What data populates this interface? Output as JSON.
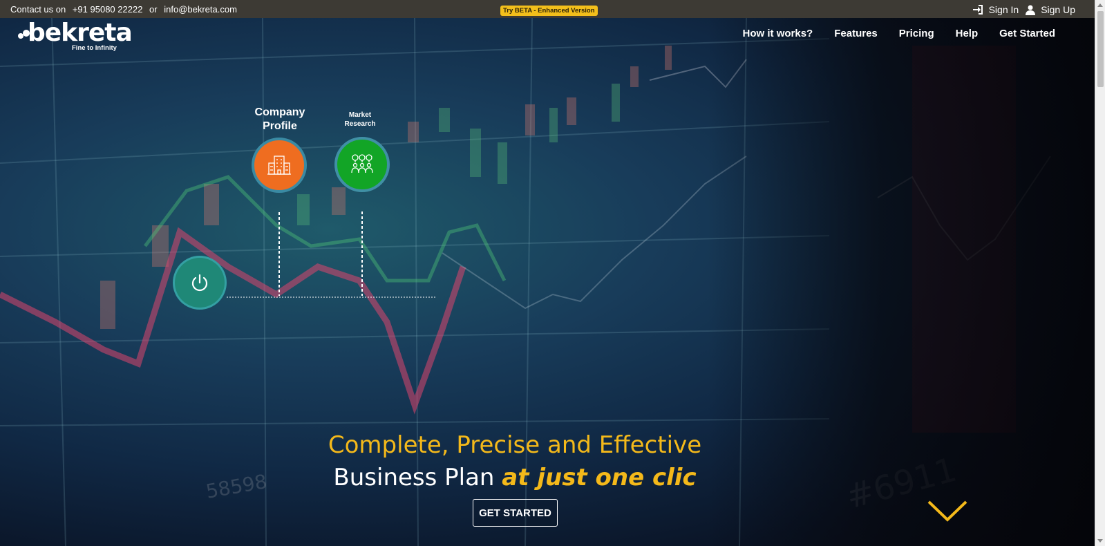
{
  "topbar": {
    "contact_label": "Contact us on",
    "phone": "+91 95080 22222",
    "or": "or",
    "email": "info@bekreta.com",
    "beta_badge": "Try BETA - Enhanced Version",
    "sign_in": "Sign In",
    "sign_up": "Sign Up"
  },
  "logo": {
    "name": "bekreta",
    "tagline": "Fine to Infinity"
  },
  "nav": {
    "items": [
      "How it works?",
      "Features",
      "Pricing",
      "Help",
      "Get Started"
    ]
  },
  "diagram": {
    "profile_label_1": "Company",
    "profile_label_2": "Profile",
    "market_label_1": "Market",
    "market_label_2": "Research"
  },
  "hero": {
    "headline_1": "Complete, Precise and Effective",
    "headline_2": "Business Plan",
    "headline_emph": "at just one clic",
    "cta": "GET STARTED"
  },
  "colors": {
    "accent": "#f4b91a",
    "orange_node": "#ef6d20",
    "green_node": "#12a526",
    "teal_node": "#1f8877",
    "topbar": "#3d3a34"
  }
}
